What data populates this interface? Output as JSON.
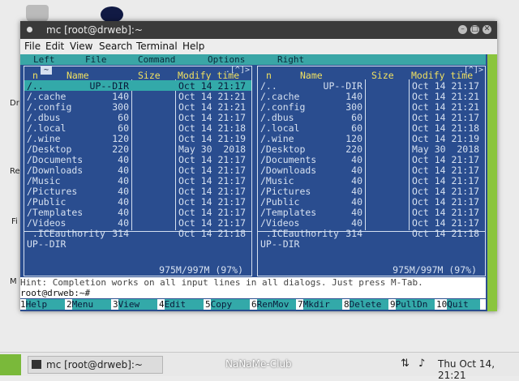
{
  "desktop": {
    "labels": [
      "Dr",
      "Re",
      "Fi",
      "M"
    ]
  },
  "window": {
    "title": "mc [root@drweb]:~",
    "controls": [
      "–",
      "□",
      "✕"
    ]
  },
  "menubar": [
    "File",
    "Edit",
    "View",
    "Search",
    "Terminal",
    "Help"
  ],
  "mc_menu": [
    "Left",
    "File",
    "Command",
    "Options",
    "Right"
  ],
  "left_panel": {
    "path_indicator": "~",
    "marker": ".[^]>",
    "columns": [
      "n",
      "Name",
      "Size",
      "Modify time"
    ],
    "rows": [
      {
        "name": "/..",
        "size": "UP--DIR",
        "time": "Oct 14 21:17",
        "selected": true
      },
      {
        "name": "/.cache",
        "size": "140",
        "time": "Oct 14 21:21"
      },
      {
        "name": "/.config",
        "size": "300",
        "time": "Oct 14 21:21"
      },
      {
        "name": "/.dbus",
        "size": "60",
        "time": "Oct 14 21:17"
      },
      {
        "name": "/.local",
        "size": "60",
        "time": "Oct 14 21:18"
      },
      {
        "name": "/.wine",
        "size": "120",
        "time": "Oct 14 21:19"
      },
      {
        "name": "/Desktop",
        "size": "220",
        "time": "May 30  2018"
      },
      {
        "name": "/Documents",
        "size": "40",
        "time": "Oct 14 21:17"
      },
      {
        "name": "/Downloads",
        "size": "40",
        "time": "Oct 14 21:17"
      },
      {
        "name": "/Music",
        "size": "40",
        "time": "Oct 14 21:17"
      },
      {
        "name": "/Pictures",
        "size": "40",
        "time": "Oct 14 21:17"
      },
      {
        "name": "/Public",
        "size": "40",
        "time": "Oct 14 21:17"
      },
      {
        "name": "/Templates",
        "size": "40",
        "time": "Oct 14 21:17"
      },
      {
        "name": "/Videos",
        "size": "40",
        "time": "Oct 14 21:17"
      },
      {
        "name": " .ICEauthority",
        "size": "314",
        "time": "Oct 14 21:18"
      }
    ],
    "status": "UP--DIR",
    "free": "975M/997M (97%)"
  },
  "right_panel": {
    "marker": ".[^]>",
    "columns": [
      "n",
      "Name",
      "Size",
      "Modify time"
    ],
    "rows": [
      {
        "name": "/..",
        "size": "UP--DIR",
        "time": "Oct 14 21:17"
      },
      {
        "name": "/.cache",
        "size": "140",
        "time": "Oct 14 21:21"
      },
      {
        "name": "/.config",
        "size": "300",
        "time": "Oct 14 21:21"
      },
      {
        "name": "/.dbus",
        "size": "60",
        "time": "Oct 14 21:17"
      },
      {
        "name": "/.local",
        "size": "60",
        "time": "Oct 14 21:18"
      },
      {
        "name": "/.wine",
        "size": "120",
        "time": "Oct 14 21:19"
      },
      {
        "name": "/Desktop",
        "size": "220",
        "time": "May 30  2018"
      },
      {
        "name": "/Documents",
        "size": "40",
        "time": "Oct 14 21:17"
      },
      {
        "name": "/Downloads",
        "size": "40",
        "time": "Oct 14 21:17"
      },
      {
        "name": "/Music",
        "size": "40",
        "time": "Oct 14 21:17"
      },
      {
        "name": "/Pictures",
        "size": "40",
        "time": "Oct 14 21:17"
      },
      {
        "name": "/Public",
        "size": "40",
        "time": "Oct 14 21:17"
      },
      {
        "name": "/Templates",
        "size": "40",
        "time": "Oct 14 21:17"
      },
      {
        "name": "/Videos",
        "size": "40",
        "time": "Oct 14 21:17"
      },
      {
        "name": " .ICEauthority",
        "size": "314",
        "time": "Oct 14 21:18"
      }
    ],
    "status": "UP--DIR",
    "free": "975M/997M (97%)"
  },
  "hint": "Hint: Completion works on all input lines in all dialogs. Just press M-Tab.",
  "prompt": "root@drweb:~#",
  "fkeys": [
    {
      "n": "1",
      "l": "Help"
    },
    {
      "n": "2",
      "l": "Menu"
    },
    {
      "n": "3",
      "l": "View"
    },
    {
      "n": "4",
      "l": "Edit"
    },
    {
      "n": "5",
      "l": "Copy"
    },
    {
      "n": "6",
      "l": "RenMov"
    },
    {
      "n": "7",
      "l": "Mkdir"
    },
    {
      "n": "8",
      "l": "Delete"
    },
    {
      "n": "9",
      "l": "PullDn"
    },
    {
      "n": "10",
      "l": "Quit"
    }
  ],
  "taskbar": {
    "task_label": "mc [root@drweb]:~",
    "watermark": "NaNaMe-Club",
    "clock": "Thu Oct 14, 21:21"
  },
  "colors": {
    "panel_bg": "#2a4d8f",
    "selection": "#33a9a9",
    "header": "#f0e060",
    "accent_green": "#8ac53e"
  }
}
